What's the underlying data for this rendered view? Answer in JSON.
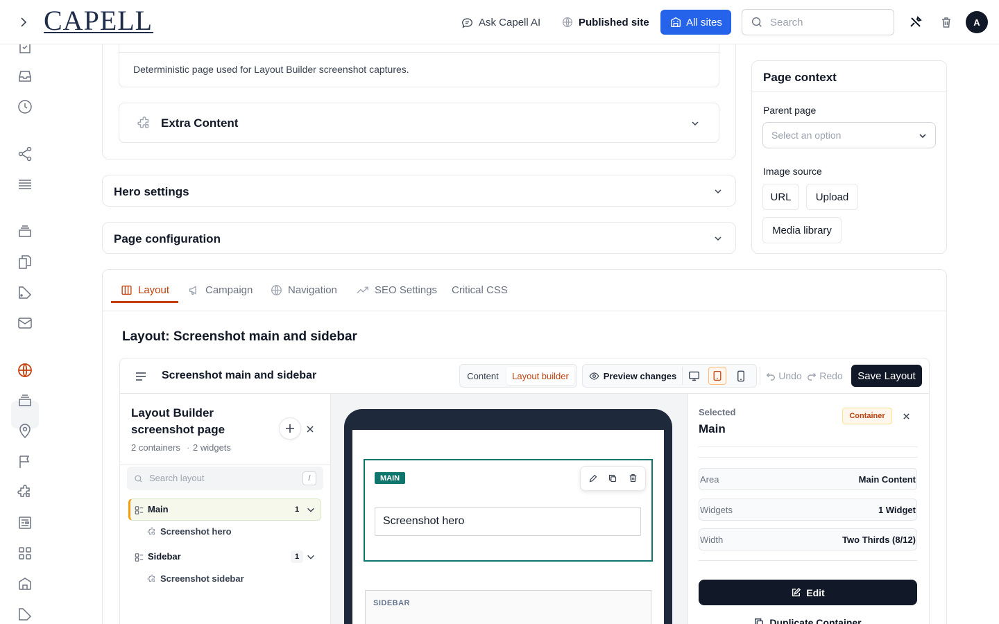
{
  "topbar": {
    "logo": "CAPELL",
    "ask_ai": "Ask Capell AI",
    "published_site": "Published site",
    "all_sites": "All sites",
    "search_placeholder": "Search",
    "avatar_initial": "A"
  },
  "content_card": {
    "description": "Deterministic page used for Layout Builder screenshot captures.",
    "extra_content": "Extra Content"
  },
  "accordions": {
    "hero_settings": "Hero settings",
    "page_configuration": "Page configuration"
  },
  "page_context": {
    "title": "Page context",
    "parent_page_label": "Parent page",
    "parent_page_placeholder": "Select an option",
    "image_source_label": "Image source",
    "image_source_options": [
      "URL",
      "Upload",
      "Media library"
    ]
  },
  "tabs": [
    {
      "label": "Layout",
      "icon": "columns-icon",
      "active": true
    },
    {
      "label": "Campaign",
      "icon": "megaphone-icon",
      "active": false
    },
    {
      "label": "Navigation",
      "icon": "globe-icon",
      "active": false
    },
    {
      "label": "SEO Settings",
      "icon": "trending-icon",
      "active": false
    },
    {
      "label": "Critical CSS",
      "icon": "",
      "active": false
    }
  ],
  "layout": {
    "heading": "Layout: Screenshot main and sidebar",
    "builder": {
      "title": "Screenshot main and sidebar",
      "mode_content": "Content",
      "mode_layout_builder": "Layout builder",
      "preview_changes": "Preview changes",
      "undo": "Undo",
      "redo": "Redo",
      "save_layout": "Save Layout",
      "tree": {
        "title": "Layout Builder screenshot page",
        "containers_count": "2 containers",
        "widgets_count": "2 widgets",
        "search_placeholder": "Search layout",
        "search_shortcut": "/",
        "items": [
          {
            "label": "Main",
            "count": "1",
            "child": "Screenshot hero",
            "selected": true
          },
          {
            "label": "Sidebar",
            "count": "1",
            "child": "Screenshot sidebar",
            "selected": false
          }
        ]
      },
      "canvas": {
        "main_tag": "MAIN",
        "hero_widget": "Screenshot hero",
        "sidebar_tag": "SIDEBAR"
      },
      "inspector": {
        "selected_label": "Selected",
        "selected_name": "Main",
        "type_badge": "Container",
        "props": [
          {
            "key": "Area",
            "value": "Main Content"
          },
          {
            "key": "Widgets",
            "value": "1 Widget"
          },
          {
            "key": "Width",
            "value": "Two Thirds (8/12)"
          }
        ],
        "edit": "Edit",
        "duplicate": "Duplicate Container"
      }
    }
  },
  "colors": {
    "accent_orange": "#c2410c",
    "primary_blue": "#2563eb",
    "main_green": "#0f766e",
    "dark": "#111827"
  }
}
